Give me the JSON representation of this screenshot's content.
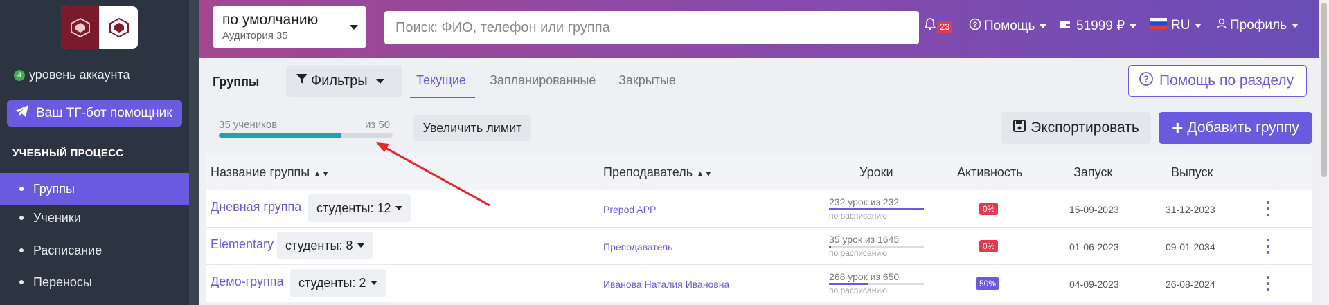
{
  "sidebar": {
    "level_number": "4",
    "level_text": "уровень аккаунта",
    "tg_button": "Ваш ТГ-бот помощник",
    "section_title": "УЧЕБНЫЙ ПРОЦЕСС",
    "items": [
      {
        "label": "Группы",
        "active": true
      },
      {
        "label": "Ученики",
        "active": false
      },
      {
        "label": "Расписание",
        "active": false
      },
      {
        "label": "Переносы",
        "active": false
      }
    ]
  },
  "topbar": {
    "school_name": "по умолчанию",
    "school_sub": "Аудитория 35",
    "search_placeholder": "Поиск: ФИО, телефон или группа",
    "notifications_count": "23",
    "help": "Помощь",
    "balance": "51999 ₽",
    "language": "RU",
    "profile": "Профиль"
  },
  "tabs": {
    "title": "Группы",
    "filters": "Фильтры",
    "current": "Текущие",
    "planned": "Запланированные",
    "closed": "Закрытые",
    "section_help": "Помощь по разделу"
  },
  "limit": {
    "students": "35 учеников",
    "of": "из 50",
    "fill_fraction": 0.7,
    "increase": "Увеличить лимит"
  },
  "actions": {
    "export": "Экспортировать",
    "add_group": "Добавить группу"
  },
  "table": {
    "headers": {
      "name": "Название группы",
      "teacher": "Преподаватель",
      "lessons": "Уроки",
      "activity": "Активность",
      "start": "Запуск",
      "end": "Выпуск"
    },
    "rows": [
      {
        "name": "Дневная группа",
        "students": "студенты: 12",
        "teacher": "Prepod APP",
        "lessons": "232 урок из 232",
        "lessons_fraction": 1.0,
        "schedule": "по расписанию",
        "activity": "0%",
        "activity_color": "#e23a4e",
        "start": "15-09-2023",
        "end": "31-12-2023"
      },
      {
        "name": "Elementary",
        "students": "студенты: 8",
        "teacher": "Преподаватель",
        "lessons": "35 урок из 1645",
        "lessons_fraction": 0.021,
        "schedule": "по расписанию",
        "activity": "0%",
        "activity_color": "#e23a4e",
        "start": "01-06-2023",
        "end": "09-01-2034"
      },
      {
        "name": "Демо-группа",
        "students": "студенты: 2",
        "teacher": "Иванова Наталия Ивановна",
        "lessons": "268 урок из 650",
        "lessons_fraction": 0.41,
        "schedule": "по расписанию",
        "activity": "50%",
        "activity_color": "#6a5ae0",
        "start": "04-09-2023",
        "end": "26-08-2024"
      }
    ]
  }
}
